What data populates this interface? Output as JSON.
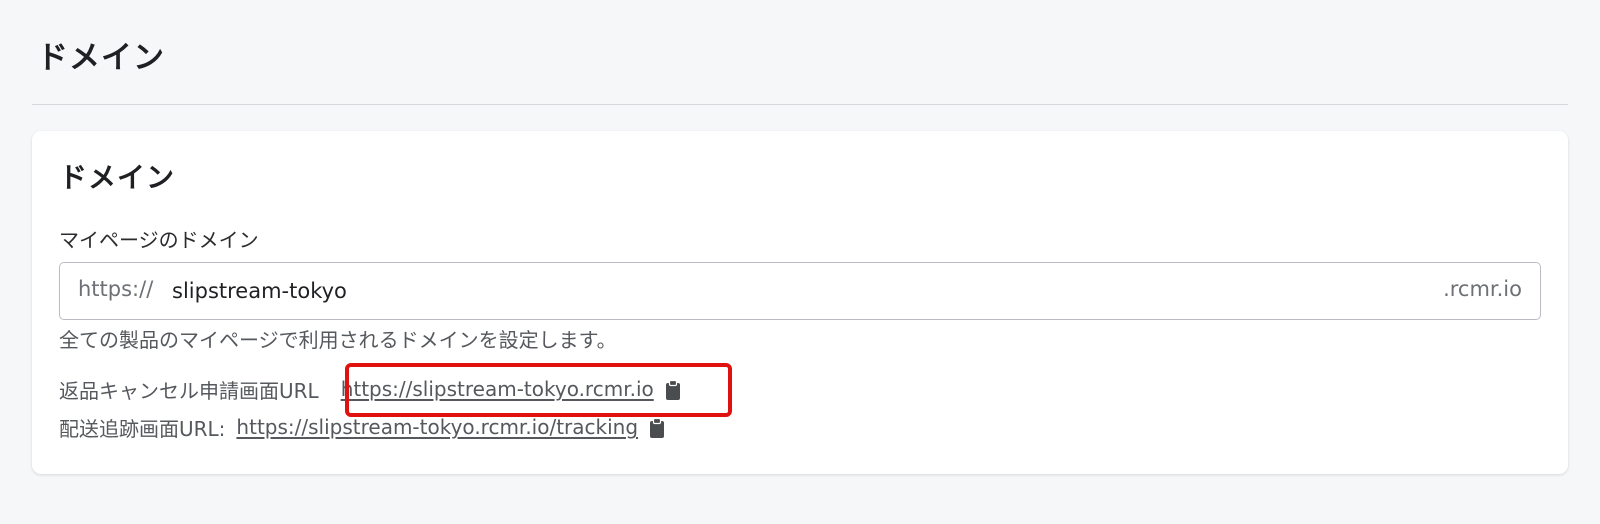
{
  "page": {
    "title": "ドメイン"
  },
  "card": {
    "title": "ドメイン",
    "field": {
      "label": "マイページのドメイン",
      "prefix": "https://",
      "value": "slipstream-tokyo",
      "suffix": ".rcmr.io"
    },
    "help_text": "全ての製品のマイページで利用されるドメインを設定します。",
    "returns_url": {
      "label": "返品キャンセル申請画面URL",
      "url": "https://slipstream-tokyo.rcmr.io",
      "icon": "clipboard-icon"
    },
    "tracking_url": {
      "label": "配送追跡画面URL:",
      "url": "https://slipstream-tokyo.rcmr.io/tracking",
      "icon": "clipboard-icon"
    }
  },
  "colors": {
    "highlight": "#e0120f",
    "background": "#f6f7f9",
    "card": "#ffffff"
  }
}
